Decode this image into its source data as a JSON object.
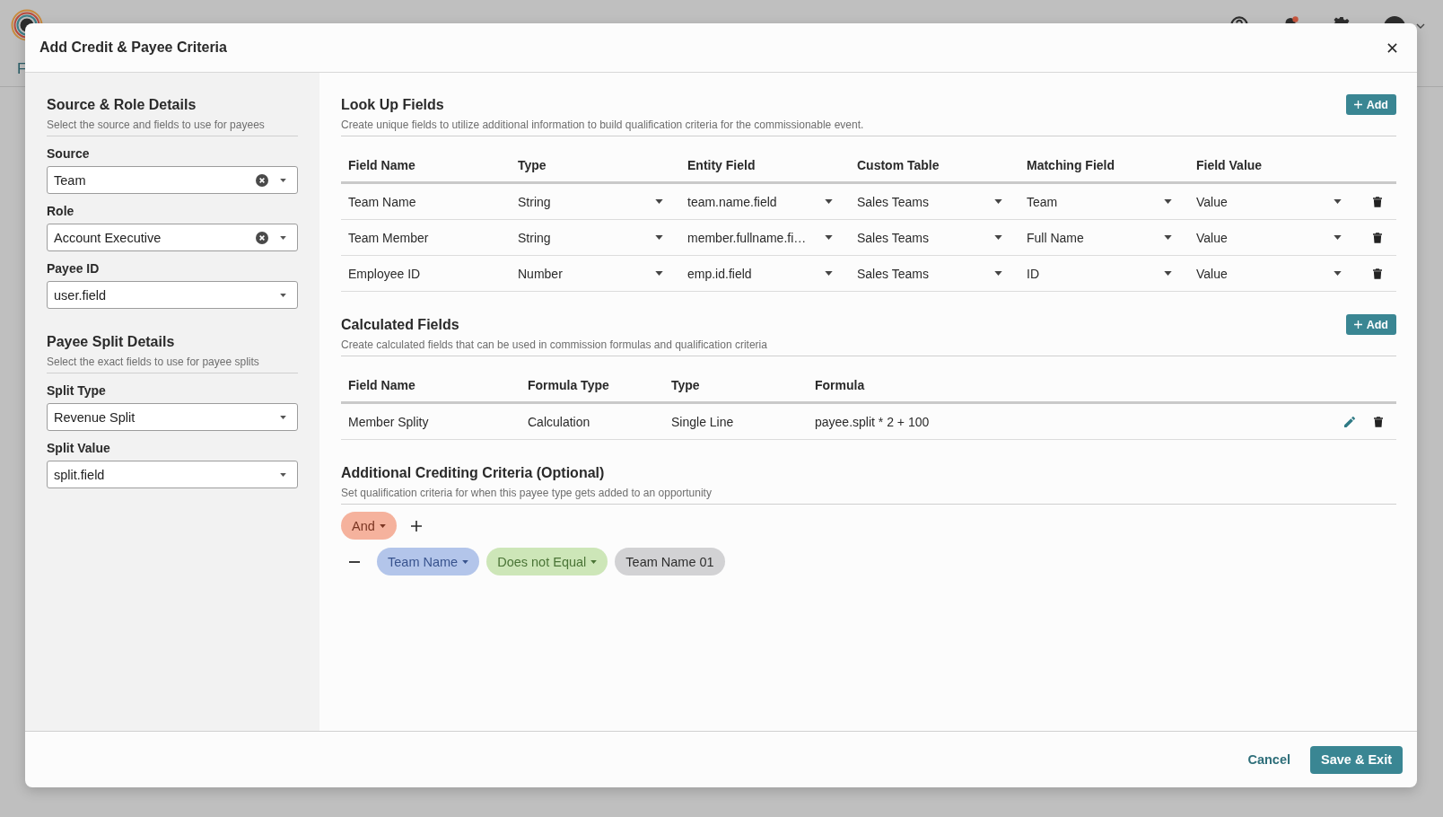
{
  "background": {
    "heading": "F"
  },
  "dialog": {
    "title": "Add Credit & Payee Criteria"
  },
  "sidebar": {
    "sections": [
      {
        "title": "Source & Role Details",
        "description": "Select the source and fields to use for payees",
        "fields": [
          {
            "label": "Source",
            "value": "Team",
            "clearable": true
          },
          {
            "label": "Role",
            "value": "Account Executive",
            "clearable": true
          },
          {
            "label": "Payee ID",
            "value": "user.field",
            "clearable": false
          }
        ]
      },
      {
        "title": "Payee Split Details",
        "description": "Select the exact fields to use for payee splits",
        "fields": [
          {
            "label": "Split Type",
            "value": "Revenue Split",
            "clearable": false
          },
          {
            "label": "Split Value",
            "value": "split.field",
            "clearable": false
          }
        ]
      }
    ]
  },
  "lookup_fields": {
    "title": "Look Up Fields",
    "description": "Create unique fields to utilize additional information to build qualification criteria for the commissionable event.",
    "add_button": "Add",
    "columns": [
      "Field Name",
      "Type",
      "Entity Field",
      "Custom Table",
      "Matching Field",
      "Field Value"
    ],
    "rows": [
      {
        "field_name": "Team Name",
        "selects": [
          "String",
          "team.name.field",
          "Sales Teams",
          "Team",
          "Value"
        ]
      },
      {
        "field_name": "Team Member",
        "selects": [
          "String",
          "member.fullname.fi…",
          "Sales Teams",
          "Full Name",
          "Value"
        ]
      },
      {
        "field_name": "Employee ID",
        "selects": [
          "Number",
          "emp.id.field",
          "Sales Teams",
          "ID",
          "Value"
        ]
      }
    ]
  },
  "calculated_fields": {
    "title": "Calculated Fields",
    "description": "Create calculated fields that can be used in commission formulas and qualification criteria",
    "add_button": "Add",
    "columns": [
      "Field Name",
      "Formula Type",
      "Type",
      "Formula"
    ],
    "rows": [
      {
        "cells": [
          "Member Splity",
          "Calculation",
          "Single Line",
          "payee.split * 2 + 100"
        ]
      }
    ]
  },
  "crediting_criteria": {
    "title": "Additional Crediting Criteria (Optional)",
    "description": "Set qualification criteria for when this payee type gets added to an opportunity",
    "operator": "And",
    "conditions": [
      {
        "parts": [
          {
            "kind": "field",
            "text": "Team Name",
            "dropdown": true
          },
          {
            "kind": "comparator",
            "text": "Does not Equal",
            "dropdown": true
          },
          {
            "kind": "value",
            "text": "Team Name 01",
            "dropdown": false
          }
        ]
      }
    ]
  },
  "footer": {
    "cancel": "Cancel",
    "save": "Save & Exit"
  }
}
